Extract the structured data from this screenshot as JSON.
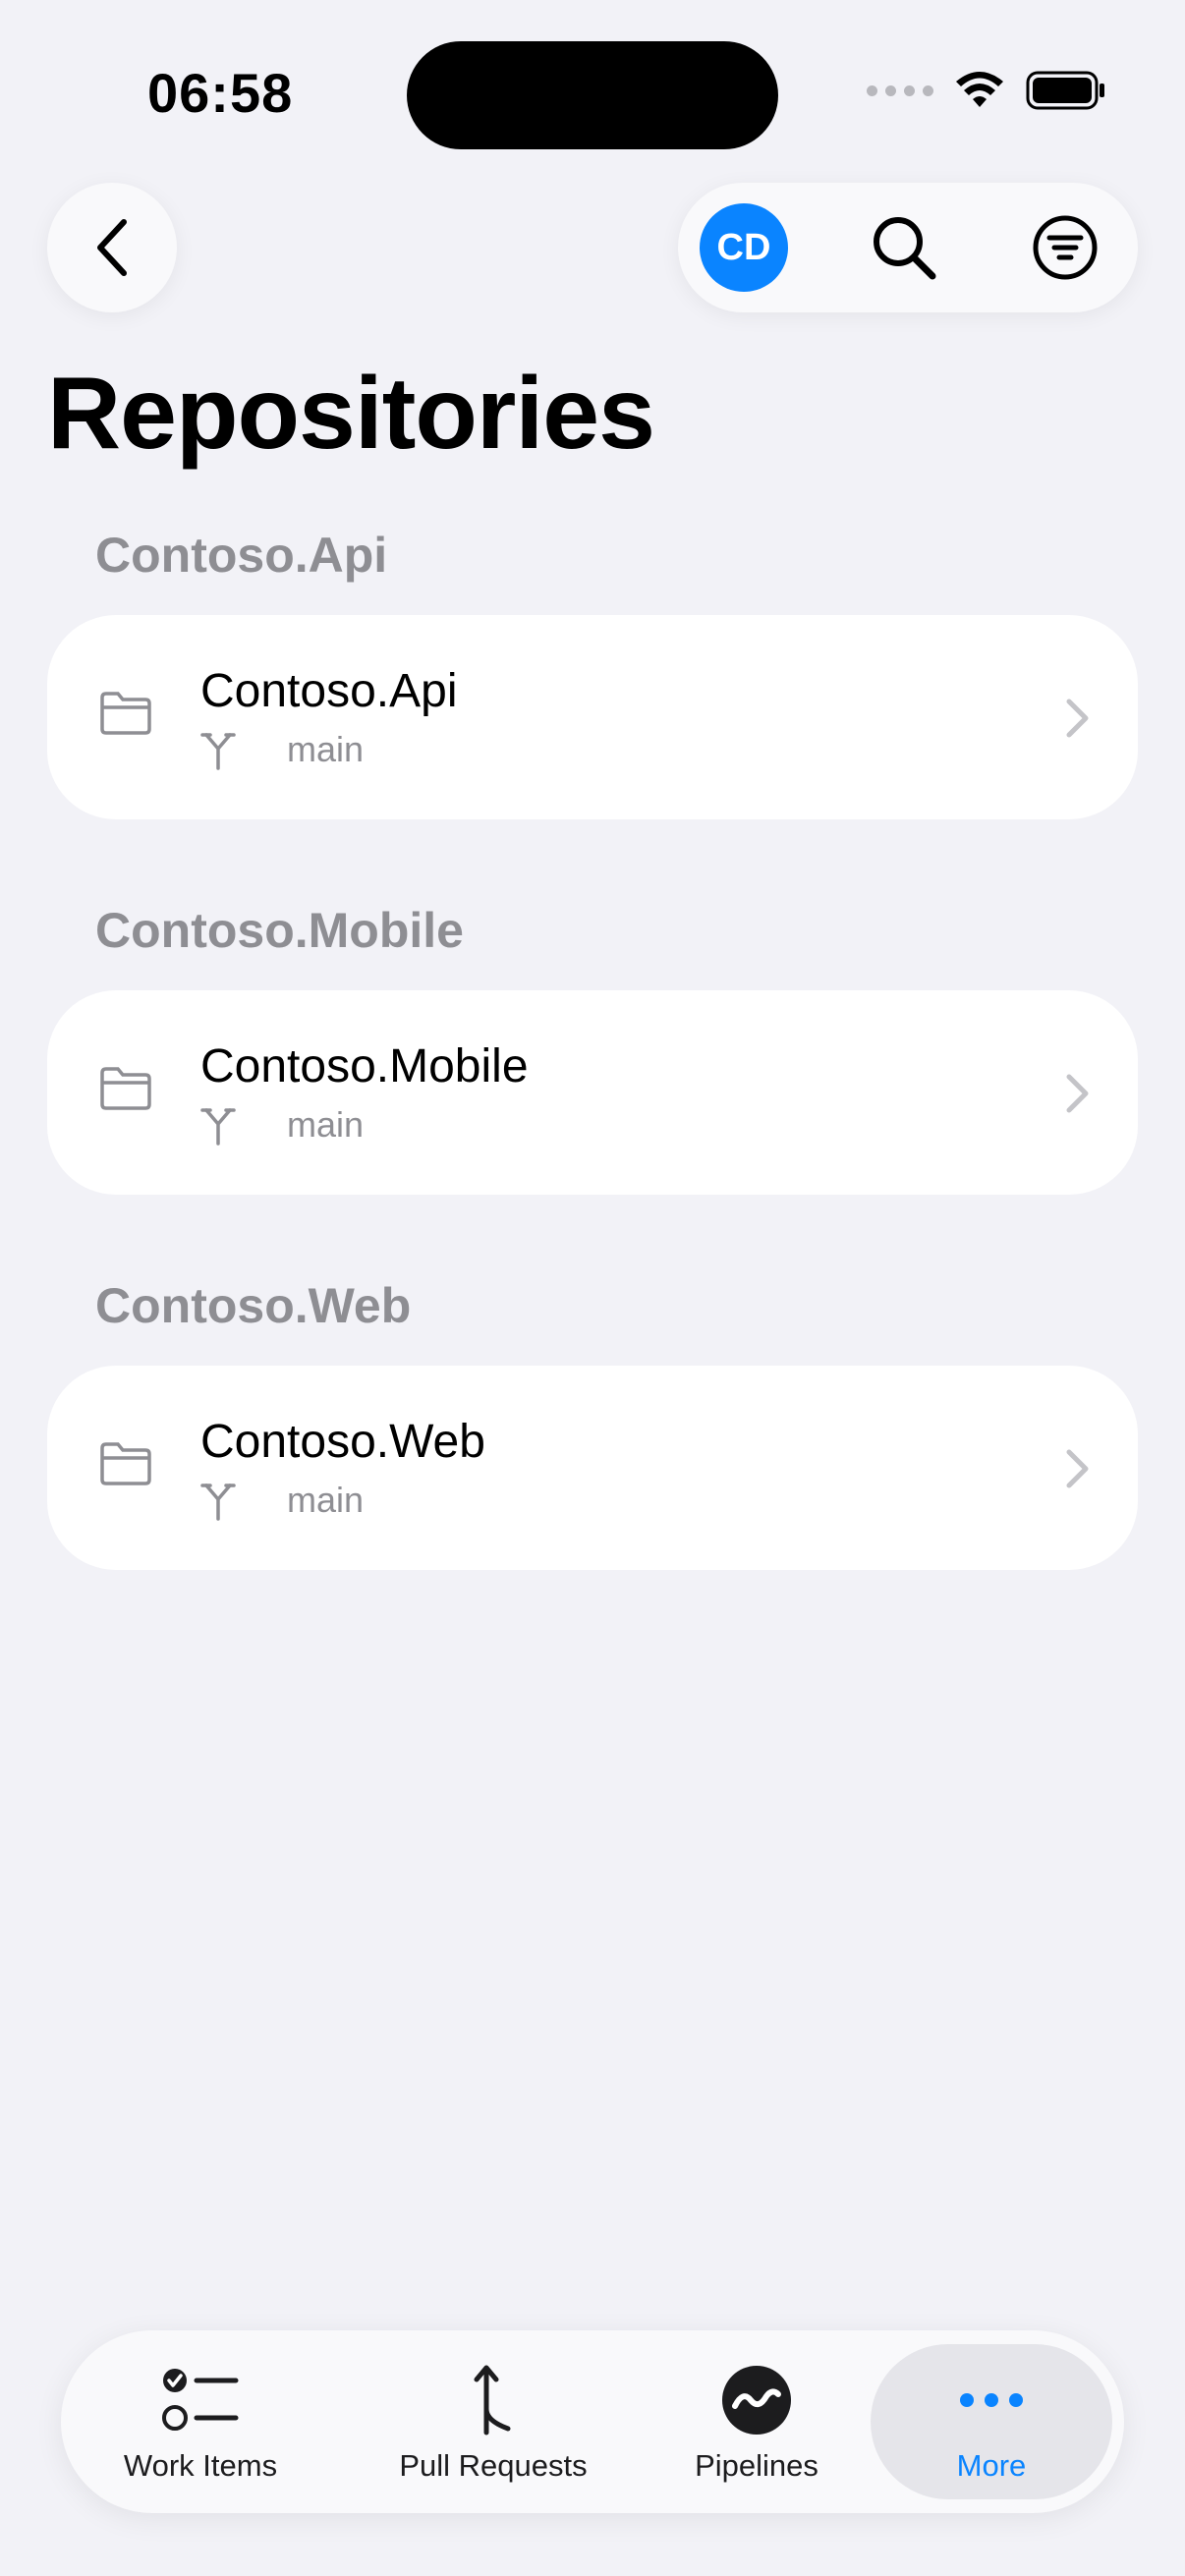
{
  "status_bar": {
    "time": "06:58"
  },
  "nav": {
    "avatar_initials": "CD"
  },
  "page": {
    "title": "Repositories"
  },
  "sections": [
    {
      "header": "Contoso.Api",
      "repo": {
        "name": "Contoso.Api",
        "branch": "main"
      }
    },
    {
      "header": "Contoso.Mobile",
      "repo": {
        "name": "Contoso.Mobile",
        "branch": "main"
      }
    },
    {
      "header": "Contoso.Web",
      "repo": {
        "name": "Contoso.Web",
        "branch": "main"
      }
    }
  ],
  "tabbar": {
    "items": [
      {
        "label": "Work Items",
        "icon": "checklist-icon"
      },
      {
        "label": "Pull Requests",
        "icon": "pull-request-icon"
      },
      {
        "label": "Pipelines",
        "icon": "pipelines-icon"
      },
      {
        "label": "More",
        "icon": "more-icon",
        "active": true
      }
    ]
  },
  "colors": {
    "accent": "#0a84ff",
    "background": "#f2f2f7",
    "secondary_text": "#8e8e93"
  }
}
